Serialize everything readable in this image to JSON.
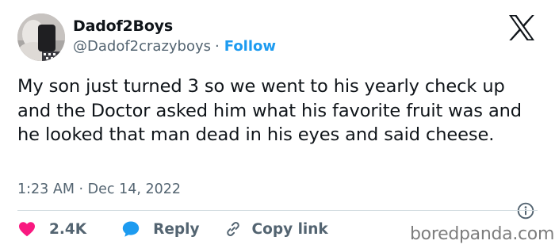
{
  "author": {
    "display_name": "Dadof2Boys",
    "handle": "@Dadof2crazyboys",
    "separator": "·",
    "follow_label": "Follow"
  },
  "tweet": {
    "text": "My son just turned 3 so we went to his yearly check up and the Doctor asked him what his favorite fruit was and he looked that man dead in his eyes and said cheese.",
    "time": "1:23 AM",
    "separator": "·",
    "date": "Dec 14, 2022"
  },
  "actions": {
    "like_count": "2.4K",
    "reply_label": "Reply",
    "copy_link_label": "Copy link"
  },
  "watermark": "boredpanda.com",
  "icons": {
    "brand": "x-logo-icon",
    "info": "info-icon",
    "like": "heart-icon",
    "reply": "speech-bubble-icon",
    "copy": "link-icon"
  },
  "colors": {
    "text": "#0f1419",
    "secondary": "#536471",
    "follow": "#1d9bf0",
    "like": "#f91880",
    "reply": "#1d9bf0",
    "divider": "#cfd9de",
    "watermark": "#7d7d7d"
  }
}
